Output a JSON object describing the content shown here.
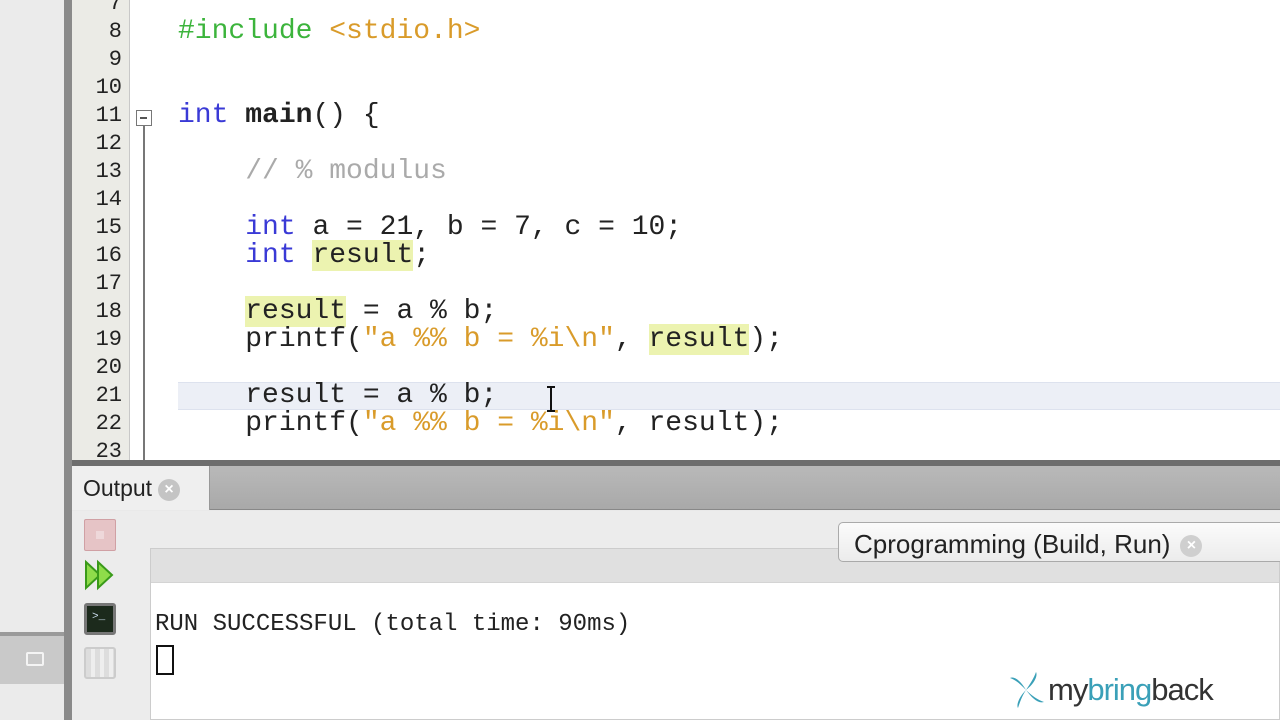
{
  "editor": {
    "first_line": 7,
    "current_line": 21,
    "lines": [
      [],
      [
        {
          "t": "#include",
          "c": "pp"
        },
        {
          "t": " "
        },
        {
          "t": "<stdio.h>",
          "c": "str"
        }
      ],
      [],
      [],
      [
        {
          "t": "int",
          "c": "kw"
        },
        {
          "t": " "
        },
        {
          "t": "main",
          "c": "fn"
        },
        {
          "t": "() {"
        }
      ],
      [],
      [
        {
          "t": "    "
        },
        {
          "t": "// % modulus",
          "c": "cm"
        }
      ],
      [],
      [
        {
          "t": "    "
        },
        {
          "t": "int",
          "c": "kw"
        },
        {
          "t": " a = 21, b = 7, c = 10;"
        }
      ],
      [
        {
          "t": "    "
        },
        {
          "t": "int",
          "c": "kw"
        },
        {
          "t": " "
        },
        {
          "t": "result",
          "c": "hl"
        },
        {
          "t": ";"
        }
      ],
      [],
      [
        {
          "t": "    "
        },
        {
          "t": "result",
          "c": "hl"
        },
        {
          "t": " = a % b;"
        }
      ],
      [
        {
          "t": "    printf("
        },
        {
          "t": "\"a %% b = %i\\n\"",
          "c": "str"
        },
        {
          "t": ", "
        },
        {
          "t": "result",
          "c": "hl"
        },
        {
          "t": ");"
        }
      ],
      [],
      [
        {
          "t": "    result = a % b;"
        }
      ],
      [
        {
          "t": "    printf("
        },
        {
          "t": "\"a %% b = %i\\n\"",
          "c": "str"
        },
        {
          "t": ", result);"
        }
      ],
      []
    ]
  },
  "output": {
    "tab_label": "Output",
    "run_tab_label": "Cprogramming (Build, Run)",
    "console_text": "RUN SUCCESSFUL (total time: 90ms)",
    "close_glyph": "×",
    "terminal_glyph": ">_"
  },
  "watermark": {
    "pre": "my",
    "accent": "bring",
    "post": "back"
  },
  "colors": {
    "keyword": "#3a3ad6",
    "string": "#d99b2a",
    "preprocessor": "#3cb43c",
    "comment": "#aaaaaa",
    "highlight": "#ecf3b0",
    "logo": "#3aa0b8"
  }
}
